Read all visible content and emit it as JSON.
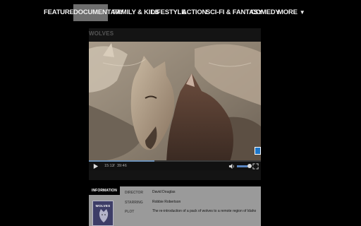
{
  "nav": {
    "items": [
      {
        "label": "FEATURED"
      },
      {
        "label": "DOCUMENTARY"
      },
      {
        "label": "FAMILY & KIDS"
      },
      {
        "label": "LIFESTYLE"
      },
      {
        "label": "ACTION"
      },
      {
        "label": "SCI-FI & FANTASY"
      },
      {
        "label": "COMEDY"
      },
      {
        "label": "MORE"
      }
    ],
    "active": "DOCUMENTARY",
    "more_caret": "▼"
  },
  "video": {
    "title": "WOLVES",
    "current_time": "15:12",
    "separator": "/",
    "duration": "39:46",
    "progress": 0.38,
    "volume": 0.75
  },
  "info": {
    "tab_label": "INFORMATION",
    "poster_title": "WOLVES",
    "director_label": "DIRECTOR",
    "director": "David Douglas",
    "starring_label": "STARRING",
    "starring": "Robbie Robertson",
    "plot_label": "PLOT",
    "plot": "The re-introduction of a pack of wolves to a remote region of Idaho"
  },
  "colors": {
    "active_tab": "#6e6e6e",
    "progress": "#6a8fb6",
    "accent_badge": "#1d76c9"
  }
}
